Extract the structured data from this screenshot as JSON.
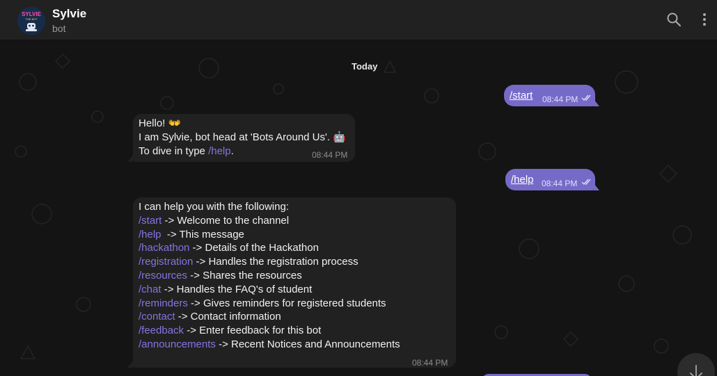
{
  "header": {
    "title": "Sylvie",
    "subtitle": "bot",
    "avatar_text_top": "SYLVIE",
    "avatar_text_bottom": "THE BOT"
  },
  "date_separator": "Today",
  "messages": [
    {
      "direction": "out",
      "command": "/start",
      "time": "08:44 PM",
      "read": true
    },
    {
      "direction": "in",
      "lines": [
        "Hello! 👐",
        "I am Sylvie, bot head at 'Bots Around Us'. 🤖"
      ],
      "help_prefix": "To dive in type ",
      "help_cmd": "/help",
      "help_suffix": ".",
      "time": "08:44 PM"
    },
    {
      "direction": "out",
      "command": "/help",
      "time": "08:44 PM",
      "read": true
    },
    {
      "direction": "in",
      "intro": "I can help you with the following:",
      "commands": [
        {
          "cmd": "/start",
          "desc": " -> Welcome to the channel"
        },
        {
          "cmd": "/help",
          "desc": "  -> This message"
        },
        {
          "cmd": "/hackathon",
          "desc": " -> Details of the Hackathon"
        },
        {
          "cmd": "/registration",
          "desc": " -> Handles the registration process"
        },
        {
          "cmd": "/resources",
          "desc": " -> Shares the resources"
        },
        {
          "cmd": "/chat",
          "desc": " -> Handles the FAQ's of student"
        },
        {
          "cmd": "/reminders",
          "desc": " -> Gives reminders for registered students"
        },
        {
          "cmd": "/contact",
          "desc": " -> Contact information"
        },
        {
          "cmd": "/feedback",
          "desc": " -> Enter feedback for this bot"
        },
        {
          "cmd": "/announcements",
          "desc": " -> Recent Notices and Announcements"
        }
      ],
      "time": "08:44 PM"
    }
  ],
  "colors": {
    "header_bg": "#212121",
    "chat_bg": "#141414",
    "incoming_bubble": "#212121",
    "outgoing_bubble": "#766ac8",
    "link": "#8774e1"
  },
  "icons": {
    "search": "search-icon",
    "menu": "more-vertical-icon",
    "scroll": "arrow-down-icon",
    "read": "double-check-icon"
  }
}
